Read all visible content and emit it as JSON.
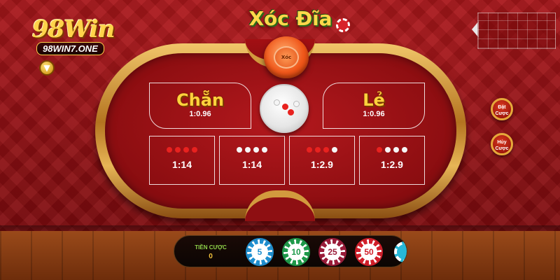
{
  "logo": {
    "main": "98Win",
    "sub": "98WIN7.ONE"
  },
  "game": {
    "title": "Xóc Đĩa"
  },
  "bowl": {
    "label": "Xóc"
  },
  "bets": {
    "even": {
      "label": "Chẵn",
      "odds": "1:0.96"
    },
    "odd": {
      "label": "Lẻ",
      "odds": "1:0.96"
    },
    "combos": [
      {
        "odds": "1:14",
        "dots": [
          "red",
          "red",
          "red",
          "red"
        ]
      },
      {
        "odds": "1:14",
        "dots": [
          "white",
          "white",
          "white",
          "white"
        ]
      },
      {
        "odds": "1:2.9",
        "dots": [
          "red",
          "red",
          "red",
          "white"
        ]
      },
      {
        "odds": "1:2.9",
        "dots": [
          "red",
          "white",
          "white",
          "white"
        ]
      }
    ]
  },
  "side_buttons": {
    "repeat_bet": "Đặt Cược",
    "cancel_bet": "Hủy Cược"
  },
  "bet_bar": {
    "label": "TIỀN CƯỢC",
    "value": "0",
    "chips": [
      {
        "label": "5",
        "color": "#1f8fd0"
      },
      {
        "label": "10",
        "color": "#1e9a4a"
      },
      {
        "label": "25",
        "color": "#9b1c3a"
      },
      {
        "label": "50",
        "color": "#d21f2a"
      }
    ]
  },
  "colors": {
    "dot_red": "#e8221f",
    "dot_white": "#f5f5f5",
    "accent_gold": "#ffd23c"
  }
}
